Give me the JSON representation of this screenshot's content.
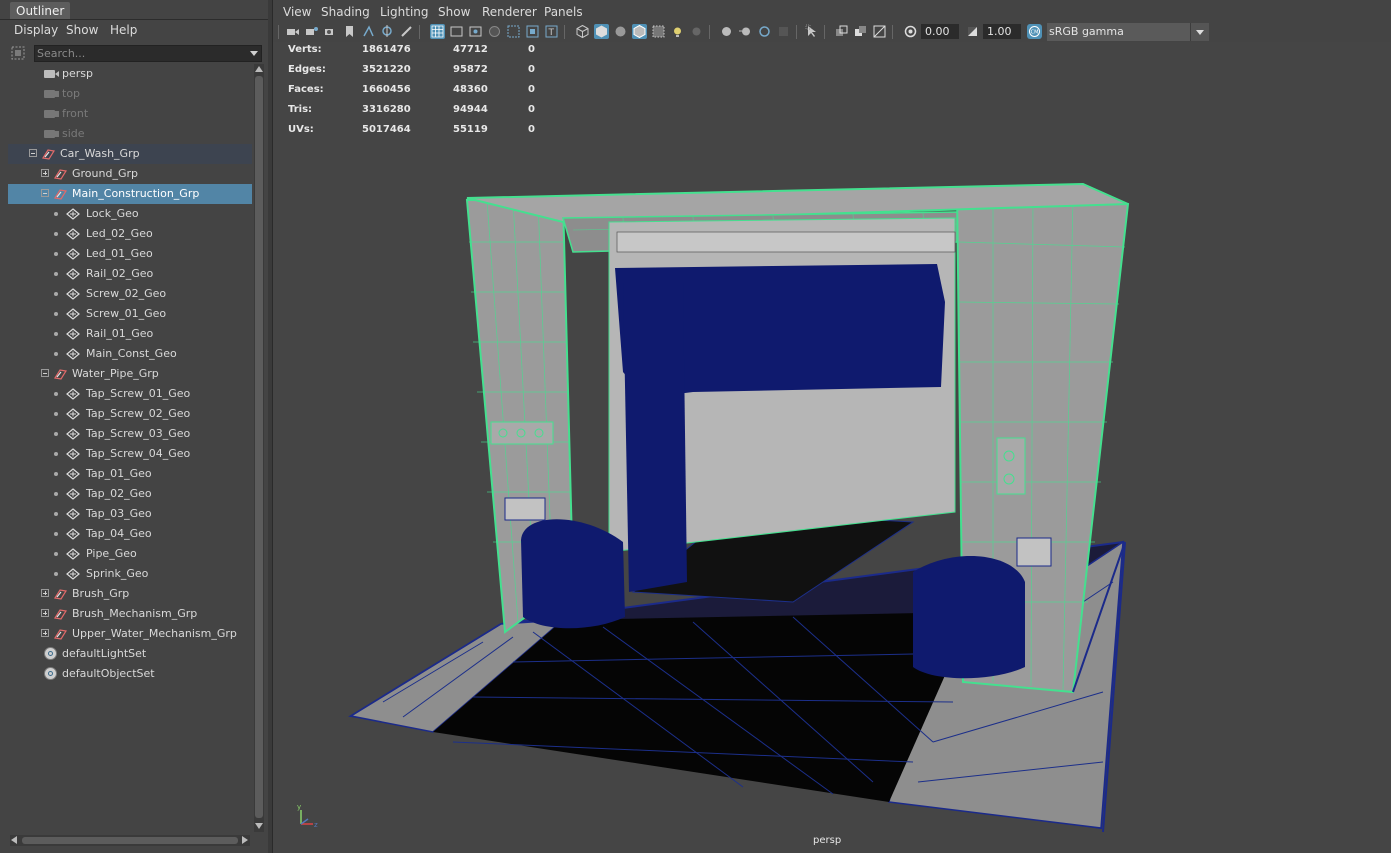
{
  "outliner": {
    "tab_title": "Outliner",
    "menus": [
      "Display",
      "Show",
      "Help"
    ],
    "search_placeholder": "Search...",
    "items": [
      {
        "label": "persp",
        "type": "camera",
        "state": "normal"
      },
      {
        "label": "top",
        "type": "camera",
        "state": "dim"
      },
      {
        "label": "front",
        "type": "camera",
        "state": "dim"
      },
      {
        "label": "side",
        "type": "camera",
        "state": "dim"
      },
      {
        "label": "Car_Wash_Grp",
        "type": "group",
        "state": "highlight",
        "expander": "minus"
      },
      {
        "label": "Ground_Grp",
        "type": "group",
        "state": "normal",
        "expander": "plus"
      },
      {
        "label": "Main_Construction_Grp",
        "type": "group",
        "state": "selected",
        "expander": "minus"
      },
      {
        "label": "Lock_Geo",
        "type": "geo",
        "state": "normal"
      },
      {
        "label": "Led_02_Geo",
        "type": "geo",
        "state": "normal"
      },
      {
        "label": "Led_01_Geo",
        "type": "geo",
        "state": "normal"
      },
      {
        "label": "Rail_02_Geo",
        "type": "geo",
        "state": "normal"
      },
      {
        "label": "Screw_02_Geo",
        "type": "geo",
        "state": "normal"
      },
      {
        "label": "Screw_01_Geo",
        "type": "geo",
        "state": "normal"
      },
      {
        "label": "Rail_01_Geo",
        "type": "geo",
        "state": "normal"
      },
      {
        "label": "Main_Const_Geo",
        "type": "geo",
        "state": "normal"
      },
      {
        "label": "Water_Pipe_Grp",
        "type": "group",
        "state": "normal",
        "expander": "minus"
      },
      {
        "label": "Tap_Screw_01_Geo",
        "type": "geo",
        "state": "normal"
      },
      {
        "label": "Tap_Screw_02_Geo",
        "type": "geo",
        "state": "normal"
      },
      {
        "label": "Tap_Screw_03_Geo",
        "type": "geo",
        "state": "normal"
      },
      {
        "label": "Tap_Screw_04_Geo",
        "type": "geo",
        "state": "normal"
      },
      {
        "label": "Tap_01_Geo",
        "type": "geo",
        "state": "normal"
      },
      {
        "label": "Tap_02_Geo",
        "type": "geo",
        "state": "normal"
      },
      {
        "label": "Tap_03_Geo",
        "type": "geo",
        "state": "normal"
      },
      {
        "label": "Tap_04_Geo",
        "type": "geo",
        "state": "normal"
      },
      {
        "label": "Pipe_Geo",
        "type": "geo",
        "state": "normal"
      },
      {
        "label": "Sprink_Geo",
        "type": "geo",
        "state": "normal"
      },
      {
        "label": "Brush_Grp",
        "type": "group",
        "state": "normal",
        "expander": "plus"
      },
      {
        "label": "Brush_Mechanism_Grp",
        "type": "group",
        "state": "normal",
        "expander": "plus"
      },
      {
        "label": "Upper_Water_Mechanism_Grp",
        "type": "group",
        "state": "normal",
        "expander": "plus"
      },
      {
        "label": "defaultLightSet",
        "type": "set",
        "state": "normal"
      },
      {
        "label": "defaultObjectSet",
        "type": "set",
        "state": "normal"
      }
    ]
  },
  "viewport": {
    "menus": [
      "View",
      "Shading",
      "Lighting",
      "Show",
      "Renderer",
      "Panels"
    ],
    "exposure": "0.00",
    "gamma": "1.00",
    "color_management": "sRGB gamma",
    "camera_label": "persp",
    "hud": [
      {
        "label": "Verts:",
        "scene": "1861476",
        "selected": "47712",
        "components": "0"
      },
      {
        "label": "Edges:",
        "scene": "3521220",
        "selected": "95872",
        "components": "0"
      },
      {
        "label": "Faces:",
        "scene": "1660456",
        "selected": "48360",
        "components": "0"
      },
      {
        "label": "Tris:",
        "scene": "3316280",
        "selected": "94944",
        "components": "0"
      },
      {
        "label": "UVs:",
        "scene": "5017464",
        "selected": "55119",
        "components": "0"
      }
    ]
  },
  "colors": {
    "selection": "#5285a6",
    "wireframe_highlight": "#44e08f",
    "brush_blue": "#0f1a6e",
    "toolbar_active": "#4f91b6"
  }
}
